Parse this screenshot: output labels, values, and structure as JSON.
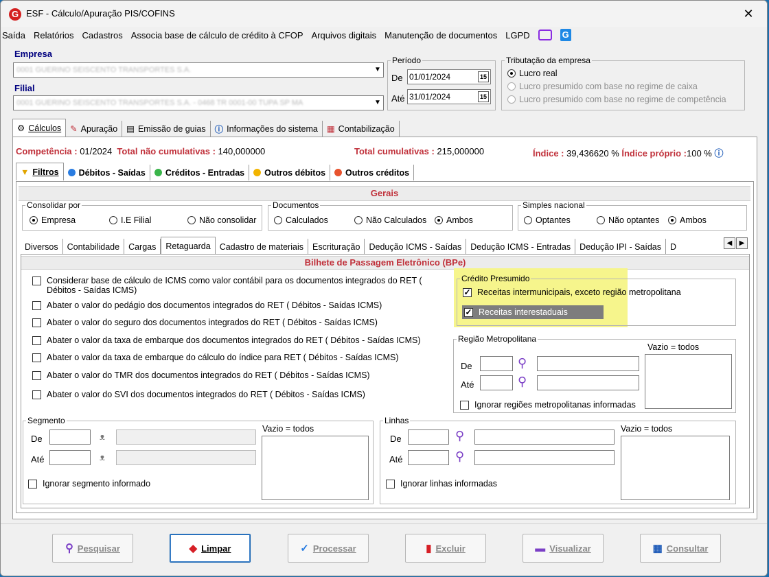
{
  "window": {
    "title": "ESF - Cálculo/Apuração PIS/COFINS",
    "close": "✕"
  },
  "menu": [
    "Saída",
    "Relatórios",
    "Cadastros",
    "Associa base de cálculo de crédito à CFOP",
    "Arquivos digitais",
    "Manutenção de documentos",
    "LGPD"
  ],
  "empresa": {
    "label": "Empresa",
    "value": "0001 GUERINO SEISCENTO TRANSPORTES S.A."
  },
  "filial": {
    "label": "Filial",
    "value": "0001 GUERINO SEISCENTO TRANSPORTES S.A. - 0468 TR 0001-00 TUPA SP MA"
  },
  "periodo": {
    "label": "Período",
    "de_label": "De",
    "de_value": "01/01/2024",
    "ate_label": "Até",
    "ate_value": "31/01/2024",
    "cal": "15"
  },
  "tributacao": {
    "label": "Tributação da empresa",
    "options": [
      "Lucro real",
      "Lucro presumido com base no regime de caixa",
      "Lucro presumido com base no regime de competência"
    ]
  },
  "main_tabs": [
    "Cálculos",
    "Apuração",
    "Emissão de guias",
    "Informações do sistema",
    "Contabilização"
  ],
  "status": {
    "competencia_label": "Competência :",
    "competencia_value": " 01/2024",
    "total_nc_label": "Total não cumulativas :",
    "total_nc_value": " 140,000000",
    "total_c_label": "Total cumulativas :",
    "total_c_value": " 215,000000",
    "indice_label": "Índice :",
    "indice_value": " 39,436620 %",
    "indice_proprio_label": "Índice próprio :",
    "indice_proprio_value": "100 %"
  },
  "sub_tabs": [
    "Filtros",
    "Débitos - Saídas",
    "Créditos - Entradas",
    "Outros débitos",
    "Outros créditos"
  ],
  "gerais": {
    "title": "Gerais",
    "consolidar": {
      "label": "Consolidar por",
      "options": [
        "Empresa",
        "I.E Filial",
        "Não consolidar"
      ]
    },
    "documentos": {
      "label": "Documentos",
      "options": [
        "Calculados",
        "Não Calculados",
        "Ambos"
      ]
    },
    "simples": {
      "label": "Simples nacional",
      "options": [
        "Optantes",
        "Não optantes",
        "Ambos"
      ]
    }
  },
  "filter_tabs": [
    "Diversos",
    "Contabilidade",
    "Cargas",
    "Retaguarda",
    "Cadastro de materiais",
    "Escrituração",
    "Dedução ICMS - Saídas",
    "Dedução ICMS - Entradas",
    "Dedução IPI - Saídas",
    "D"
  ],
  "bpe": {
    "title": "Bilhete de Passagem Eletrônico (BPe)",
    "checks": [
      "Considerar base de cálculo de ICMS como valor contábil para os documentos integrados do RET ( Débitos - Saídas ICMS)",
      "Abater o valor do pedágio dos documentos integrados do RET ( Débitos - Saídas ICMS)",
      "Abater o valor do seguro dos documentos integrados do RET ( Débitos - Saídas ICMS)",
      "Abater o valor da taxa de embarque dos documentos integrados do RET ( Débitos - Saídas ICMS)",
      "Abater o valor da taxa de embarque do cálculo do índice para RET ( Débitos - Saídas ICMS)",
      "Abater o valor do TMR dos documentos integrados do RET ( Débitos - Saídas ICMS)",
      "Abater o valor do SVI dos documentos integrados do RET ( Débitos - Saídas ICMS)"
    ],
    "credito": {
      "label": "Crédito Presumido",
      "opt1": "Receitas intermunicipais, exceto região metropolitana",
      "opt2": "Receitas interestaduais",
      "mark": "✓"
    },
    "regiao": {
      "label": "Região Metropolitana",
      "de": "De",
      "ate": "Até",
      "vazio": "Vazio = todos",
      "ignorar": "Ignorar regiões metropolitanas informadas"
    }
  },
  "segmento": {
    "label": "Segmento",
    "de": "De",
    "ate": "Até",
    "vazio": "Vazio = todos",
    "ignorar": "Ignorar segmento informado"
  },
  "linhas": {
    "label": "Linhas",
    "de": "De",
    "ate": "Até",
    "vazio": "Vazio = todos",
    "ignorar": "Ignorar linhas informadas"
  },
  "buttons": {
    "pesquisar": "Pesquisar",
    "limpar": "Limpar",
    "processar": "Processar",
    "excluir": "Excluir",
    "visualizar": "Visualizar",
    "consultar": "Consultar"
  },
  "colors": {
    "accent_red": "#c0303a",
    "highlight": "#f6f58c",
    "primary_blue": "#0b5cad"
  }
}
